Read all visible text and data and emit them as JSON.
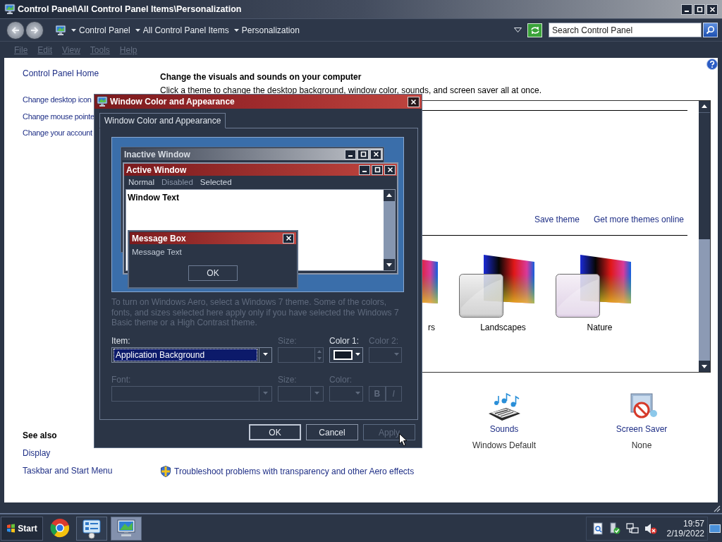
{
  "window": {
    "title": "Control Panel\\All Control Panel Items\\Personalization"
  },
  "address_bar": {
    "breadcrumb": [
      "Control Panel",
      "All Control Panel Items",
      "Personalization"
    ],
    "search": {
      "placeholder": "Search Control Panel"
    }
  },
  "menu": [
    "File",
    "Edit",
    "View",
    "Tools",
    "Help"
  ],
  "left_pane": {
    "home": "Control Panel Home",
    "tasks": [
      "Change desktop icon",
      "Change mouse pointe",
      "Change your account"
    ],
    "see_also": {
      "title": "See also",
      "links": [
        "Display",
        "Taskbar and Start Menu"
      ]
    }
  },
  "main": {
    "heading": "Change the visuals and sounds on your computer",
    "subtext": "Click a theme to change the desktop background, window color, sounds, and screen saver all at once.",
    "theme_links": [
      "Save theme",
      "Get more themes online"
    ],
    "themes": [
      {
        "label": "rs",
        "partial": true
      },
      {
        "label": "Landscapes",
        "partial": false
      },
      {
        "label": "Nature",
        "partial": false
      }
    ],
    "settings": [
      {
        "kind": "sounds",
        "label": "Sounds",
        "value": "Windows Default"
      },
      {
        "kind": "screen_saver",
        "label": "Screen Saver",
        "value": "None"
      }
    ],
    "troubleshoot": "Troubleshoot problems with transparency and other Aero effects"
  },
  "dialog": {
    "title": "Window Color and Appearance",
    "tabs": [
      {
        "label": "Window Color and Appearance",
        "selected": true
      }
    ],
    "preview": {
      "inactive_title": "Inactive Window",
      "active_title": "Active Window",
      "menu": [
        {
          "label": "Normal",
          "disabled": false
        },
        {
          "label": "Disabled",
          "disabled": true
        },
        {
          "label": "Selected",
          "disabled": false
        }
      ],
      "window_text": "Window Text",
      "message_box": {
        "title": "Message Box",
        "text": "Message Text",
        "button": "OK"
      }
    },
    "note": "To turn on Windows Aero, select a Windows 7 theme.  Some of the colors, fonts, and sizes selected here apply only if you have selected the Windows 7 Basic theme or a High Contrast theme.",
    "rows": [
      [
        {
          "kind": "combo",
          "label": "Item:",
          "value": "Application Background",
          "disabled": false
        },
        {
          "kind": "spin",
          "label": "Size:",
          "disabled": true
        },
        {
          "kind": "color",
          "label": "Color 1:",
          "disabled": false
        },
        {
          "kind": "color",
          "label": "Color 2:",
          "disabled": true
        }
      ],
      [
        {
          "kind": "combo",
          "label": "Font:",
          "disabled": true
        },
        {
          "kind": "combo",
          "label": "Size:",
          "disabled": true
        },
        {
          "kind": "color",
          "label": "Color:",
          "disabled": true
        },
        {
          "kind": "styles",
          "buttons": [
            "B",
            "I"
          ],
          "disabled": true
        }
      ]
    ],
    "buttons": [
      {
        "label": "OK",
        "disabled": false
      },
      {
        "label": "Cancel",
        "disabled": false
      },
      {
        "label": "Apply",
        "disabled": true
      }
    ]
  },
  "taskbar": {
    "start": "Start",
    "tasks": [
      {
        "kind": "chrome",
        "running": false,
        "selected": false
      },
      {
        "kind": "control_panel",
        "running": true,
        "selected": false
      },
      {
        "kind": "display",
        "running": true,
        "selected": true
      }
    ],
    "time": "19:57",
    "date": "2/19/2022"
  }
}
